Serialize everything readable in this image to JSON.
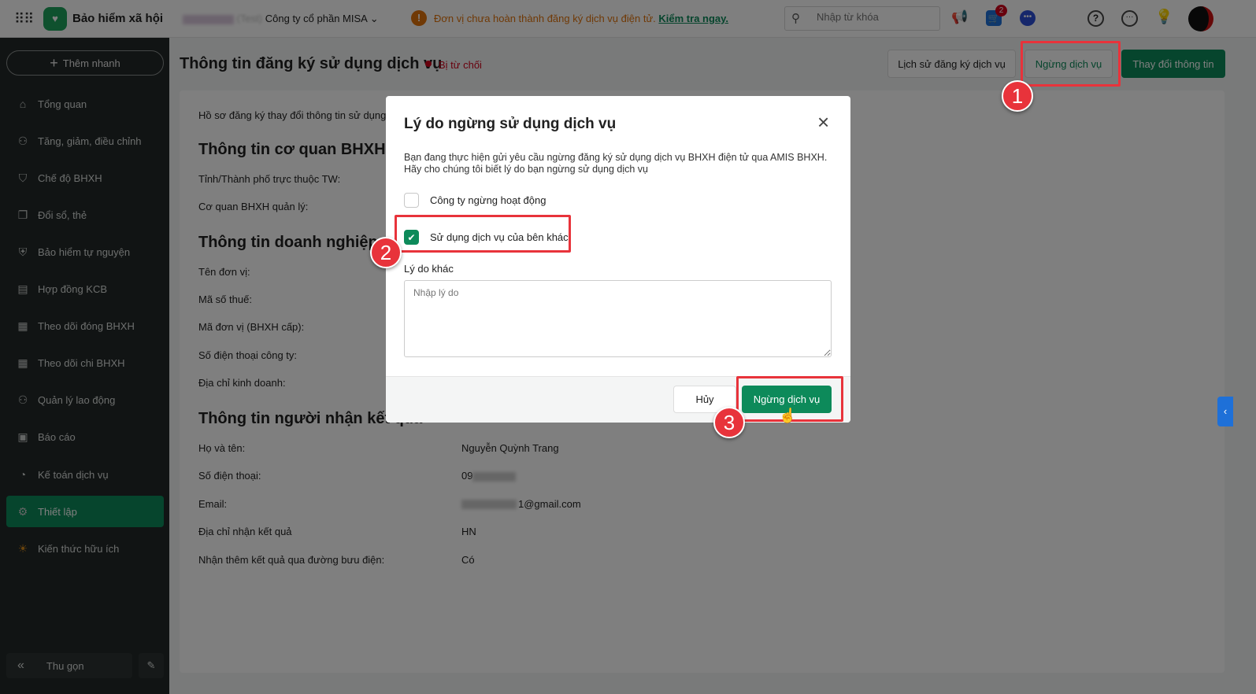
{
  "topbar": {
    "app_name": "Bảo hiểm xã hội",
    "company_tag": "(Test)",
    "company": "Công ty cổ phần MISA",
    "warning": "Đơn vị chưa hoàn thành đăng ký dịch vụ điện tử.",
    "warning_link": "Kiểm tra ngay.",
    "search_placeholder": "Nhập từ khóa",
    "cart_badge": "2"
  },
  "sidebar": {
    "quick_add": "Thêm nhanh",
    "items": [
      {
        "label": "Tổng quan",
        "icon": "home-icon"
      },
      {
        "label": "Tăng, giảm, điều chỉnh",
        "icon": "user-up-icon"
      },
      {
        "label": "Chế độ BHXH",
        "icon": "shield-heart-icon"
      },
      {
        "label": "Đổi sổ, thẻ",
        "icon": "copy-icon"
      },
      {
        "label": "Bảo hiểm tự nguyện",
        "icon": "shield-icon"
      },
      {
        "label": "Hợp đồng KCB",
        "icon": "contract-icon"
      },
      {
        "label": "Theo dõi đóng BHXH",
        "icon": "doc-plus-icon"
      },
      {
        "label": "Theo dõi chi BHXH",
        "icon": "doc-plus-icon"
      },
      {
        "label": "Quản lý lao động",
        "icon": "users-icon"
      },
      {
        "label": "Báo cáo",
        "icon": "report-icon"
      },
      {
        "label": "Kế toán dịch vụ",
        "icon": "accounting-icon"
      },
      {
        "label": "Thiết lập",
        "icon": "gear-icon"
      },
      {
        "label": "Kiến thức hữu ích",
        "icon": "bulb-icon"
      }
    ],
    "collapse": "Thu gọn"
  },
  "page": {
    "title": "Thông tin đăng ký sử dụng dịch vụ",
    "status": "Bị từ chối",
    "btn_history": "Lịch sử đăng ký dịch vụ",
    "btn_stop": "Ngừng dịch vụ",
    "btn_change": "Thay đổi thông tin",
    "intro": "Hồ sơ đăng ký thay đổi thông tin sử dụng dịch vụ",
    "sec1": "Thông tin cơ quan BHXH quản lý",
    "province": "Tỉnh/Thành phố trực thuộc TW:",
    "agency": "Cơ quan BHXH quản lý:",
    "sec2": "Thông tin doanh nghiệp",
    "unit_name": "Tên đơn vị:",
    "tax": "Mã số thuế:",
    "unit_code": "Mã đơn vị (BHXH cấp):",
    "phone_co": "Số điện thoại công ty:",
    "address": "Địa chỉ kinh doanh:",
    "sec3": "Thông tin người nhận kết quả",
    "receiver": [
      {
        "label": "Họ và tên:",
        "value": "Nguyễn Quỳnh Trang"
      },
      {
        "label": "Số điện thoại:",
        "value": "09"
      },
      {
        "label": "Email:",
        "value": "1@gmail.com"
      },
      {
        "label": "Địa chỉ nhận kết quả",
        "value": "HN"
      },
      {
        "label": "Nhận thêm kết quả qua đường bưu điện:",
        "value": "Có"
      }
    ]
  },
  "dialog": {
    "title": "Lý do ngừng sử dụng dịch vụ",
    "desc1": "Bạn đang thực hiện gửi yêu cầu ngừng đăng ký sử dụng dịch vụ BHXH điện tử qua AMIS BHXH.",
    "desc2": "Hãy cho chúng tôi biết lý do bạn ngừng sử dụng dịch vụ",
    "opt1": "Công ty ngừng hoạt động",
    "opt1_checked": false,
    "opt2": "Sử dụng dịch vụ của bên khác",
    "opt2_checked": true,
    "other_label": "Lý do khác",
    "other_placeholder": "Nhập lý do",
    "other_value": "",
    "cancel": "Hủy",
    "confirm": "Ngừng dịch vụ"
  },
  "steps": [
    "1",
    "2",
    "3"
  ],
  "colors": {
    "primary": "#0d8a5a",
    "highlight": "#e8333b",
    "sidebar": "#232928"
  }
}
